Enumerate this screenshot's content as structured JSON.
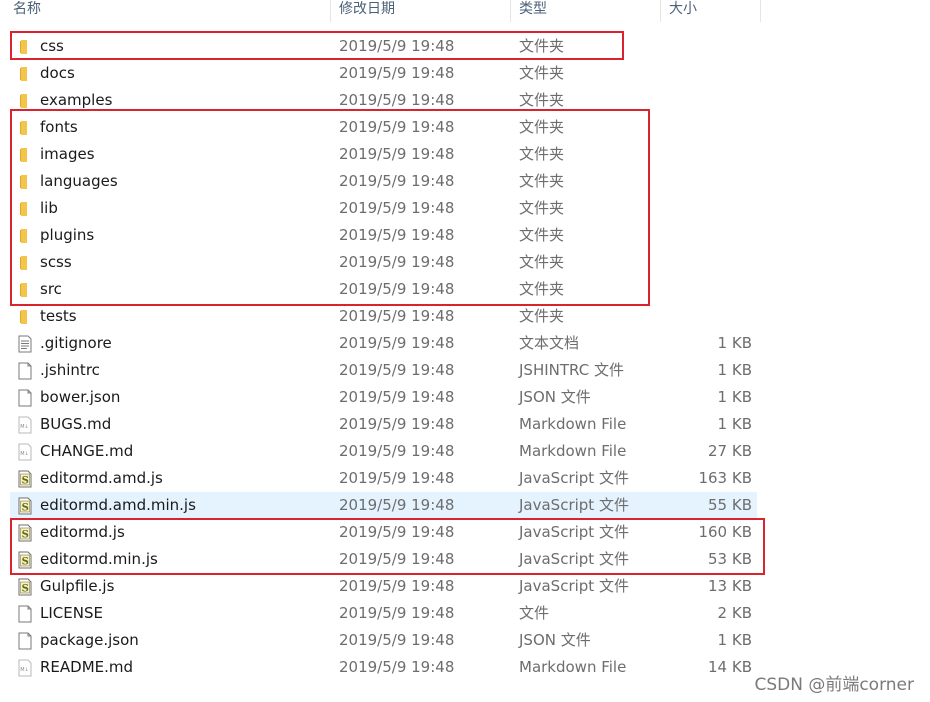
{
  "columns": {
    "name": "名称",
    "date": "修改日期",
    "type": "类型",
    "size": "大小"
  },
  "rows": [
    {
      "name": "css",
      "date": "2019/5/9 19:48",
      "type": "文件夹",
      "size": "",
      "icon": "folder-icon"
    },
    {
      "name": "docs",
      "date": "2019/5/9 19:48",
      "type": "文件夹",
      "size": "",
      "icon": "folder-icon"
    },
    {
      "name": "examples",
      "date": "2019/5/9 19:48",
      "type": "文件夹",
      "size": "",
      "icon": "folder-icon"
    },
    {
      "name": "fonts",
      "date": "2019/5/9 19:48",
      "type": "文件夹",
      "size": "",
      "icon": "folder-icon"
    },
    {
      "name": "images",
      "date": "2019/5/9 19:48",
      "type": "文件夹",
      "size": "",
      "icon": "folder-icon"
    },
    {
      "name": "languages",
      "date": "2019/5/9 19:48",
      "type": "文件夹",
      "size": "",
      "icon": "folder-icon"
    },
    {
      "name": "lib",
      "date": "2019/5/9 19:48",
      "type": "文件夹",
      "size": "",
      "icon": "folder-icon"
    },
    {
      "name": "plugins",
      "date": "2019/5/9 19:48",
      "type": "文件夹",
      "size": "",
      "icon": "folder-icon"
    },
    {
      "name": "scss",
      "date": "2019/5/9 19:48",
      "type": "文件夹",
      "size": "",
      "icon": "folder-icon"
    },
    {
      "name": "src",
      "date": "2019/5/9 19:48",
      "type": "文件夹",
      "size": "",
      "icon": "folder-icon"
    },
    {
      "name": "tests",
      "date": "2019/5/9 19:48",
      "type": "文件夹",
      "size": "",
      "icon": "folder-icon"
    },
    {
      "name": ".gitignore",
      "date": "2019/5/9 19:48",
      "type": "文本文档",
      "size": "1 KB",
      "icon": "text-file-icon"
    },
    {
      "name": ".jshintrc",
      "date": "2019/5/9 19:48",
      "type": "JSHINTRC 文件",
      "size": "1 KB",
      "icon": "blank-file-icon"
    },
    {
      "name": "bower.json",
      "date": "2019/5/9 19:48",
      "type": "JSON 文件",
      "size": "1 KB",
      "icon": "blank-file-icon"
    },
    {
      "name": "BUGS.md",
      "date": "2019/5/9 19:48",
      "type": "Markdown File",
      "size": "1 KB",
      "icon": "markdown-file-icon"
    },
    {
      "name": "CHANGE.md",
      "date": "2019/5/9 19:48",
      "type": "Markdown File",
      "size": "27 KB",
      "icon": "markdown-file-icon"
    },
    {
      "name": "editormd.amd.js",
      "date": "2019/5/9 19:48",
      "type": "JavaScript 文件",
      "size": "163 KB",
      "icon": "js-file-icon"
    },
    {
      "name": "editormd.amd.min.js",
      "date": "2019/5/9 19:48",
      "type": "JavaScript 文件",
      "size": "55 KB",
      "icon": "js-file-icon",
      "selected": true
    },
    {
      "name": "editormd.js",
      "date": "2019/5/9 19:48",
      "type": "JavaScript 文件",
      "size": "160 KB",
      "icon": "js-file-icon"
    },
    {
      "name": "editormd.min.js",
      "date": "2019/5/9 19:48",
      "type": "JavaScript 文件",
      "size": "53 KB",
      "icon": "js-file-icon"
    },
    {
      "name": "Gulpfile.js",
      "date": "2019/5/9 19:48",
      "type": "JavaScript 文件",
      "size": "13 KB",
      "icon": "js-file-icon"
    },
    {
      "name": "LICENSE",
      "date": "2019/5/9 19:48",
      "type": "文件",
      "size": "2 KB",
      "icon": "blank-file-icon"
    },
    {
      "name": "package.json",
      "date": "2019/5/9 19:48",
      "type": "JSON 文件",
      "size": "1 KB",
      "icon": "blank-file-icon"
    },
    {
      "name": "README.md",
      "date": "2019/5/9 19:48",
      "type": "Markdown File",
      "size": "14 KB",
      "icon": "markdown-file-icon"
    }
  ],
  "colors": {
    "highlight": "#d9232e",
    "selection": "#e5f3ff",
    "folder": "#f3c54b"
  },
  "watermark": "CSDN @前端corner"
}
